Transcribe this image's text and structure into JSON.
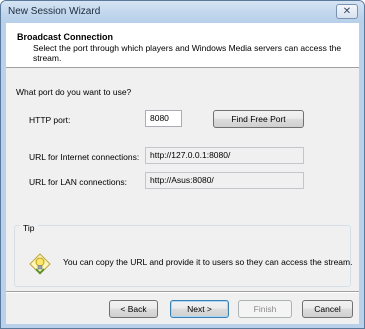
{
  "window": {
    "title": "New Session Wizard"
  },
  "header": {
    "title": "Broadcast Connection",
    "description": "Select the port through which players and Windows Media servers can access the stream."
  },
  "form": {
    "question": "What port do you want to use?",
    "http_port_label": "HTTP port:",
    "http_port_value": "8080",
    "find_free_port_label": "Find Free Port",
    "internet_url_label": "URL for Internet connections:",
    "internet_url_value": "http://127.0.0.1:8080/",
    "lan_url_label": "URL for LAN connections:",
    "lan_url_value": "http://Asus:8080/"
  },
  "tip": {
    "legend": "Tip",
    "text": "You can copy the URL and provide it to users so they can access the stream."
  },
  "buttons": {
    "back": "< Back",
    "next": "Next >",
    "finish": "Finish",
    "cancel": "Cancel"
  }
}
